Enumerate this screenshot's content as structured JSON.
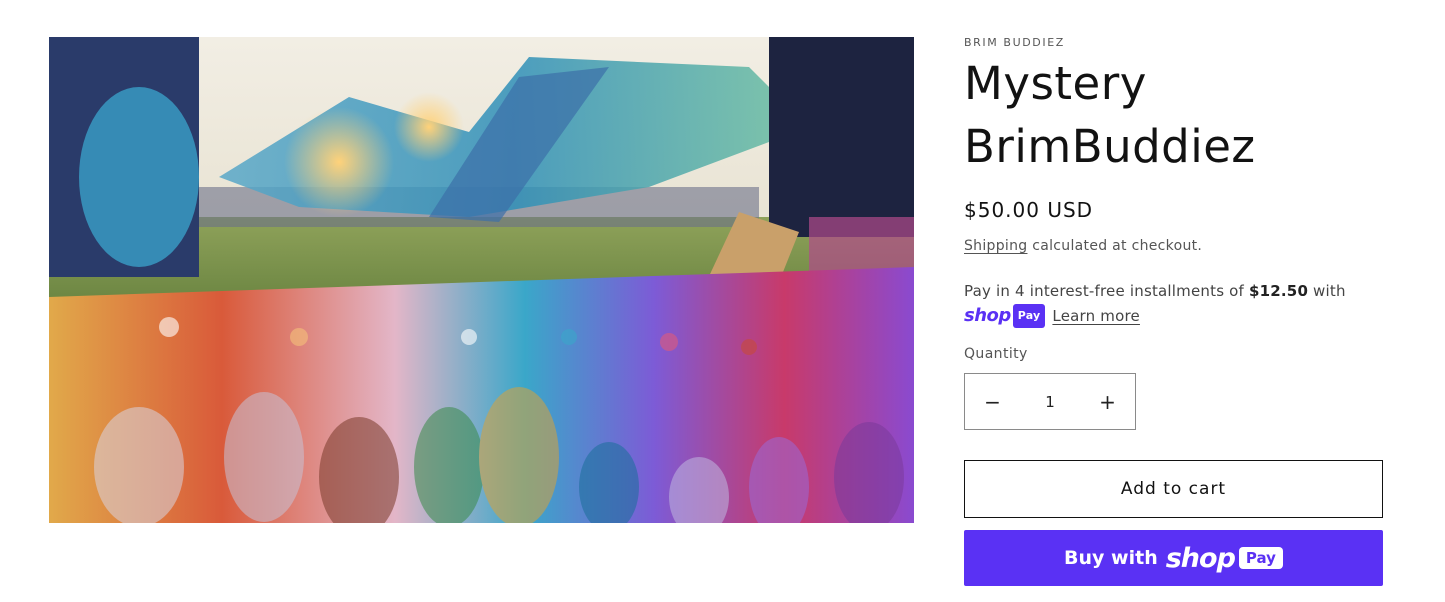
{
  "media": {
    "image_alt": "Festival scene with rows of colorful figurines"
  },
  "product": {
    "vendor": "BRIM BUDDIEZ",
    "title": "Mystery BrimBuddiez",
    "price": "$50.00 USD",
    "shipping_link": "Shipping",
    "shipping_suffix": " calculated at checkout."
  },
  "installments": {
    "prefix": "Pay in 4 interest-free installments of ",
    "amount": "$12.50",
    "suffix": " with",
    "shop_word": "shop",
    "pay_word": "Pay",
    "learn_more": "Learn more"
  },
  "quantity": {
    "label": "Quantity",
    "value": "1",
    "decrease_symbol": "−",
    "increase_symbol": "+"
  },
  "actions": {
    "add_to_cart": "Add to cart",
    "buy_with": "Buy with",
    "buy_shop": "shop",
    "buy_pay": "Pay"
  },
  "colors": {
    "shop_pay_purple": "#5a31f4",
    "text": "#121212"
  }
}
